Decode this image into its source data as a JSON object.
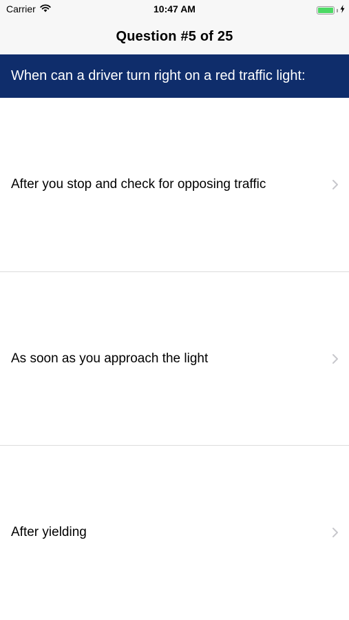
{
  "status_bar": {
    "carrier": "Carrier",
    "time": "10:47 AM",
    "battery_level": 1.0,
    "battery_color": "#4cd964"
  },
  "nav": {
    "title": "Question #5 of 25"
  },
  "question": {
    "text": "When can a driver turn right on a red traffic light:",
    "banner_color": "#0f2d6b"
  },
  "answers": [
    {
      "label": "After you stop and check for opposing traffic",
      "icon": "chevron-right-icon"
    },
    {
      "label": "As soon as you approach the light",
      "icon": "chevron-right-icon"
    },
    {
      "label": "After yielding",
      "icon": "chevron-right-icon"
    }
  ]
}
